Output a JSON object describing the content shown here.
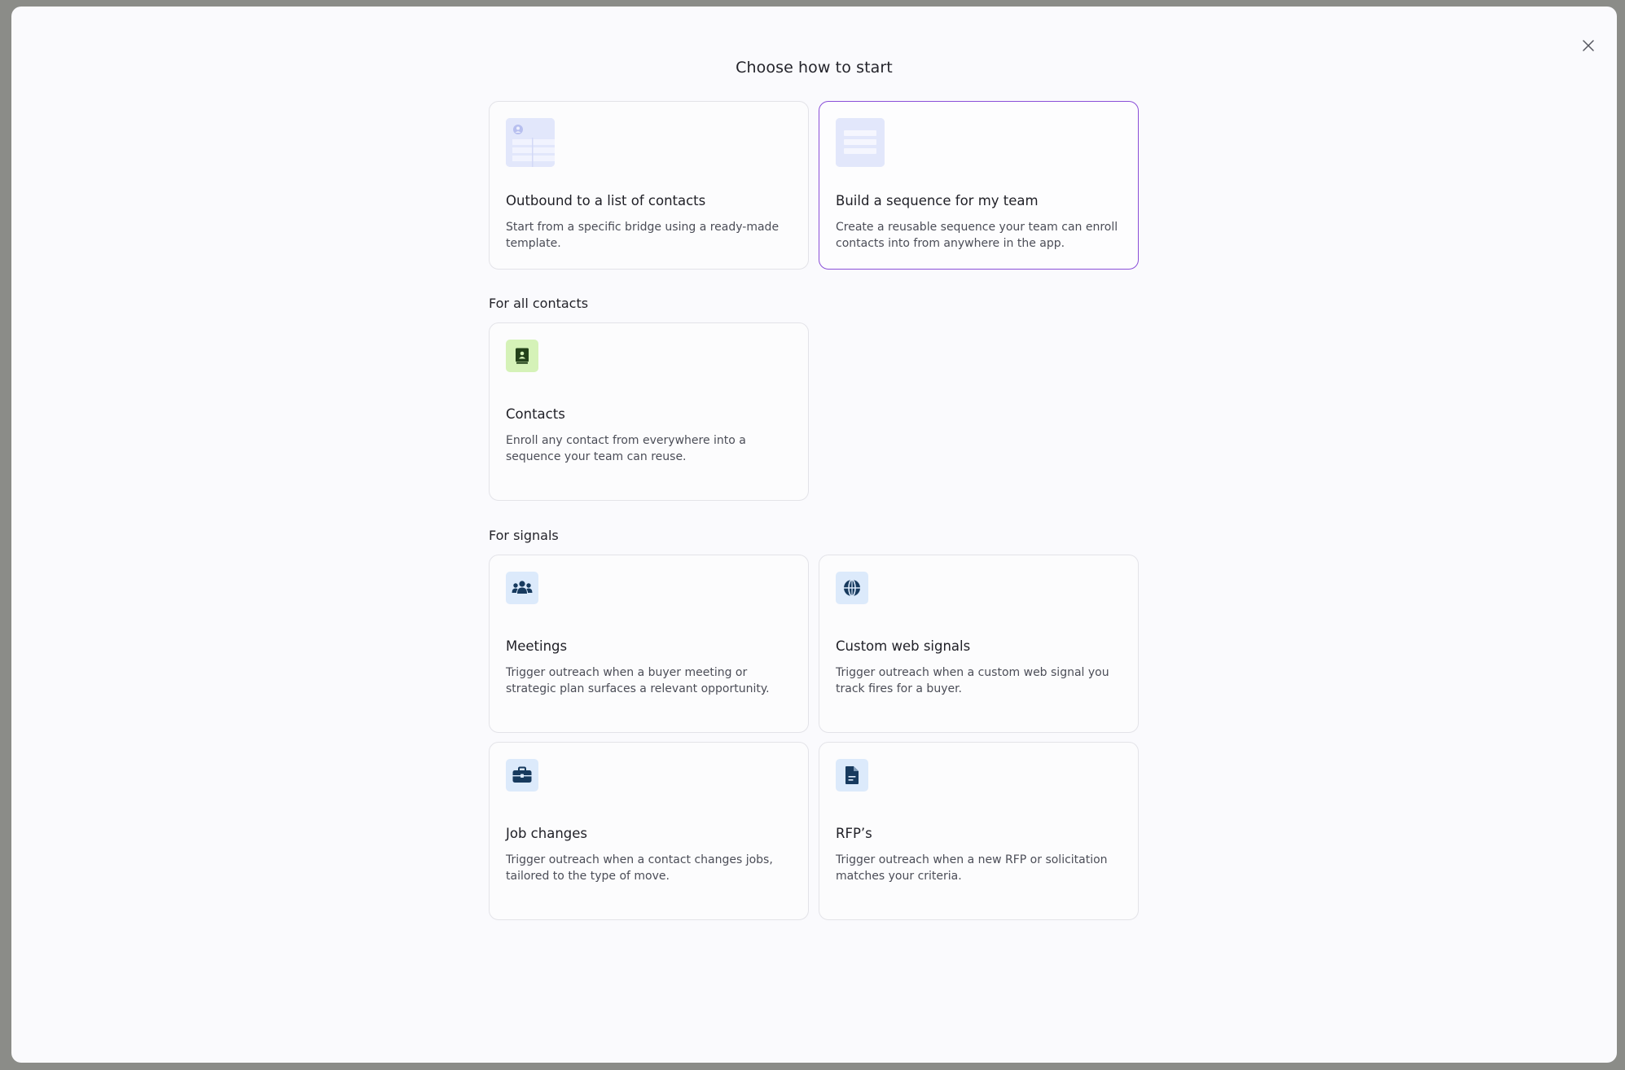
{
  "modal": {
    "title": "Choose how to start",
    "close_icon": "close-icon"
  },
  "top_options": [
    {
      "title": "Outbound to a list of contacts",
      "description": "Start from a specific bridge using a ready-made template.",
      "icon": "contact-list-template-icon",
      "selected": false
    },
    {
      "title": "Build a sequence for my team",
      "description": "Create a reusable sequence your team can enroll contacts into from anywhere in the app.",
      "icon": "sequence-template-icon",
      "selected": true
    }
  ],
  "sections": {
    "all_contacts": {
      "label": "For all contacts",
      "items": [
        {
          "title": "Contacts",
          "description": "Enroll any contact from everywhere into a sequence your team can reuse.",
          "icon": "address-book-icon"
        }
      ]
    },
    "signals": {
      "label": "For signals",
      "items": [
        {
          "title": "Meetings",
          "description": "Trigger outreach when a buyer meeting or strategic plan surfaces a relevant opportunity.",
          "icon": "people-group-icon"
        },
        {
          "title": "Custom web signals",
          "description": "Trigger outreach when a custom web signal you track fires for a buyer.",
          "icon": "globe-icon"
        },
        {
          "title": "Job changes",
          "description": "Trigger outreach when a contact changes jobs, tailored to the type of move.",
          "icon": "briefcase-icon"
        },
        {
          "title": "RFP’s",
          "description": "Trigger outreach when a new RFP or solicitation matches your criteria.",
          "icon": "document-icon"
        }
      ]
    }
  },
  "colors": {
    "selected_border": "#8a4fd8",
    "icon_blue_bg": "#dceafb",
    "icon_green_bg": "#d5f2b8",
    "icon_navy": "#173a5e",
    "icon_dark_green": "#23411a"
  }
}
